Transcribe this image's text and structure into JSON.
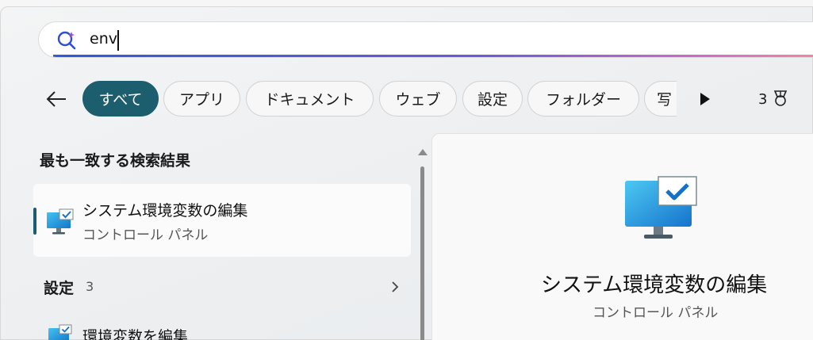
{
  "search": {
    "query": "env"
  },
  "filters": [
    {
      "label": "すべて",
      "active": true
    },
    {
      "label": "アプリ",
      "active": false
    },
    {
      "label": "ドキュメント",
      "active": false
    },
    {
      "label": "ウェブ",
      "active": false
    },
    {
      "label": "設定",
      "active": false
    },
    {
      "label": "フォルダー",
      "active": false
    },
    {
      "label": "写",
      "active": false
    }
  ],
  "rewards": {
    "count": "3"
  },
  "left": {
    "best_match_heading": "最も一致する検索結果",
    "best_match": {
      "title": "システム環境変数の編集",
      "subtitle": "コントロール パネル"
    },
    "settings": {
      "heading": "設定",
      "count": "3",
      "items": [
        {
          "title": "環境変数を編集"
        }
      ]
    }
  },
  "preview": {
    "title": "システム環境変数の編集",
    "subtitle": "コントロール パネル"
  },
  "colors": {
    "accent": "#1d5e6e",
    "monitor": "#1e9be0",
    "check": "#1570c8"
  }
}
